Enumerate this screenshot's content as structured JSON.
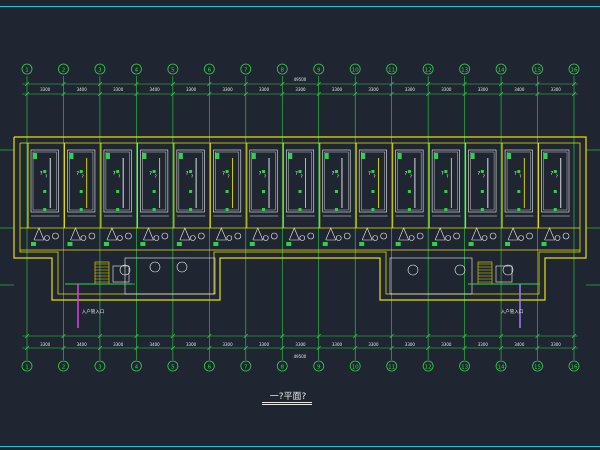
{
  "drawing": {
    "title": "一?平面?",
    "axis_labels": [
      "1",
      "2",
      "3",
      "4",
      "5",
      "6",
      "7",
      "8",
      "9",
      "10",
      "11",
      "12",
      "13",
      "14",
      "15",
      "16"
    ],
    "top_dimensions": [
      "3300",
      "3400",
      "3300",
      "3400",
      "3300",
      "3300",
      "3300",
      "3300",
      "3300",
      "3300",
      "3300",
      "3300",
      "3300",
      "3400",
      "3300"
    ],
    "bottom_dimensions": [
      "3300",
      "3400",
      "3300",
      "3400",
      "3300",
      "3300",
      "3300",
      "3300",
      "3300",
      "3300",
      "3300",
      "3300",
      "3300",
      "3400",
      "3300"
    ],
    "top_total": "49500",
    "bottom_total": "49500",
    "entry_labels": [
      "入户管入口",
      "入户管入口"
    ],
    "colors": {
      "background": "#1f2631",
      "frame": "#19c6d8",
      "wall": "#e8e000",
      "axis": "#2fd24a",
      "text": "#e8e8e8",
      "pipe_white": "#f2f2f2",
      "pipe_magenta": "#e23be8",
      "pipe_purple": "#9b7bff"
    }
  }
}
